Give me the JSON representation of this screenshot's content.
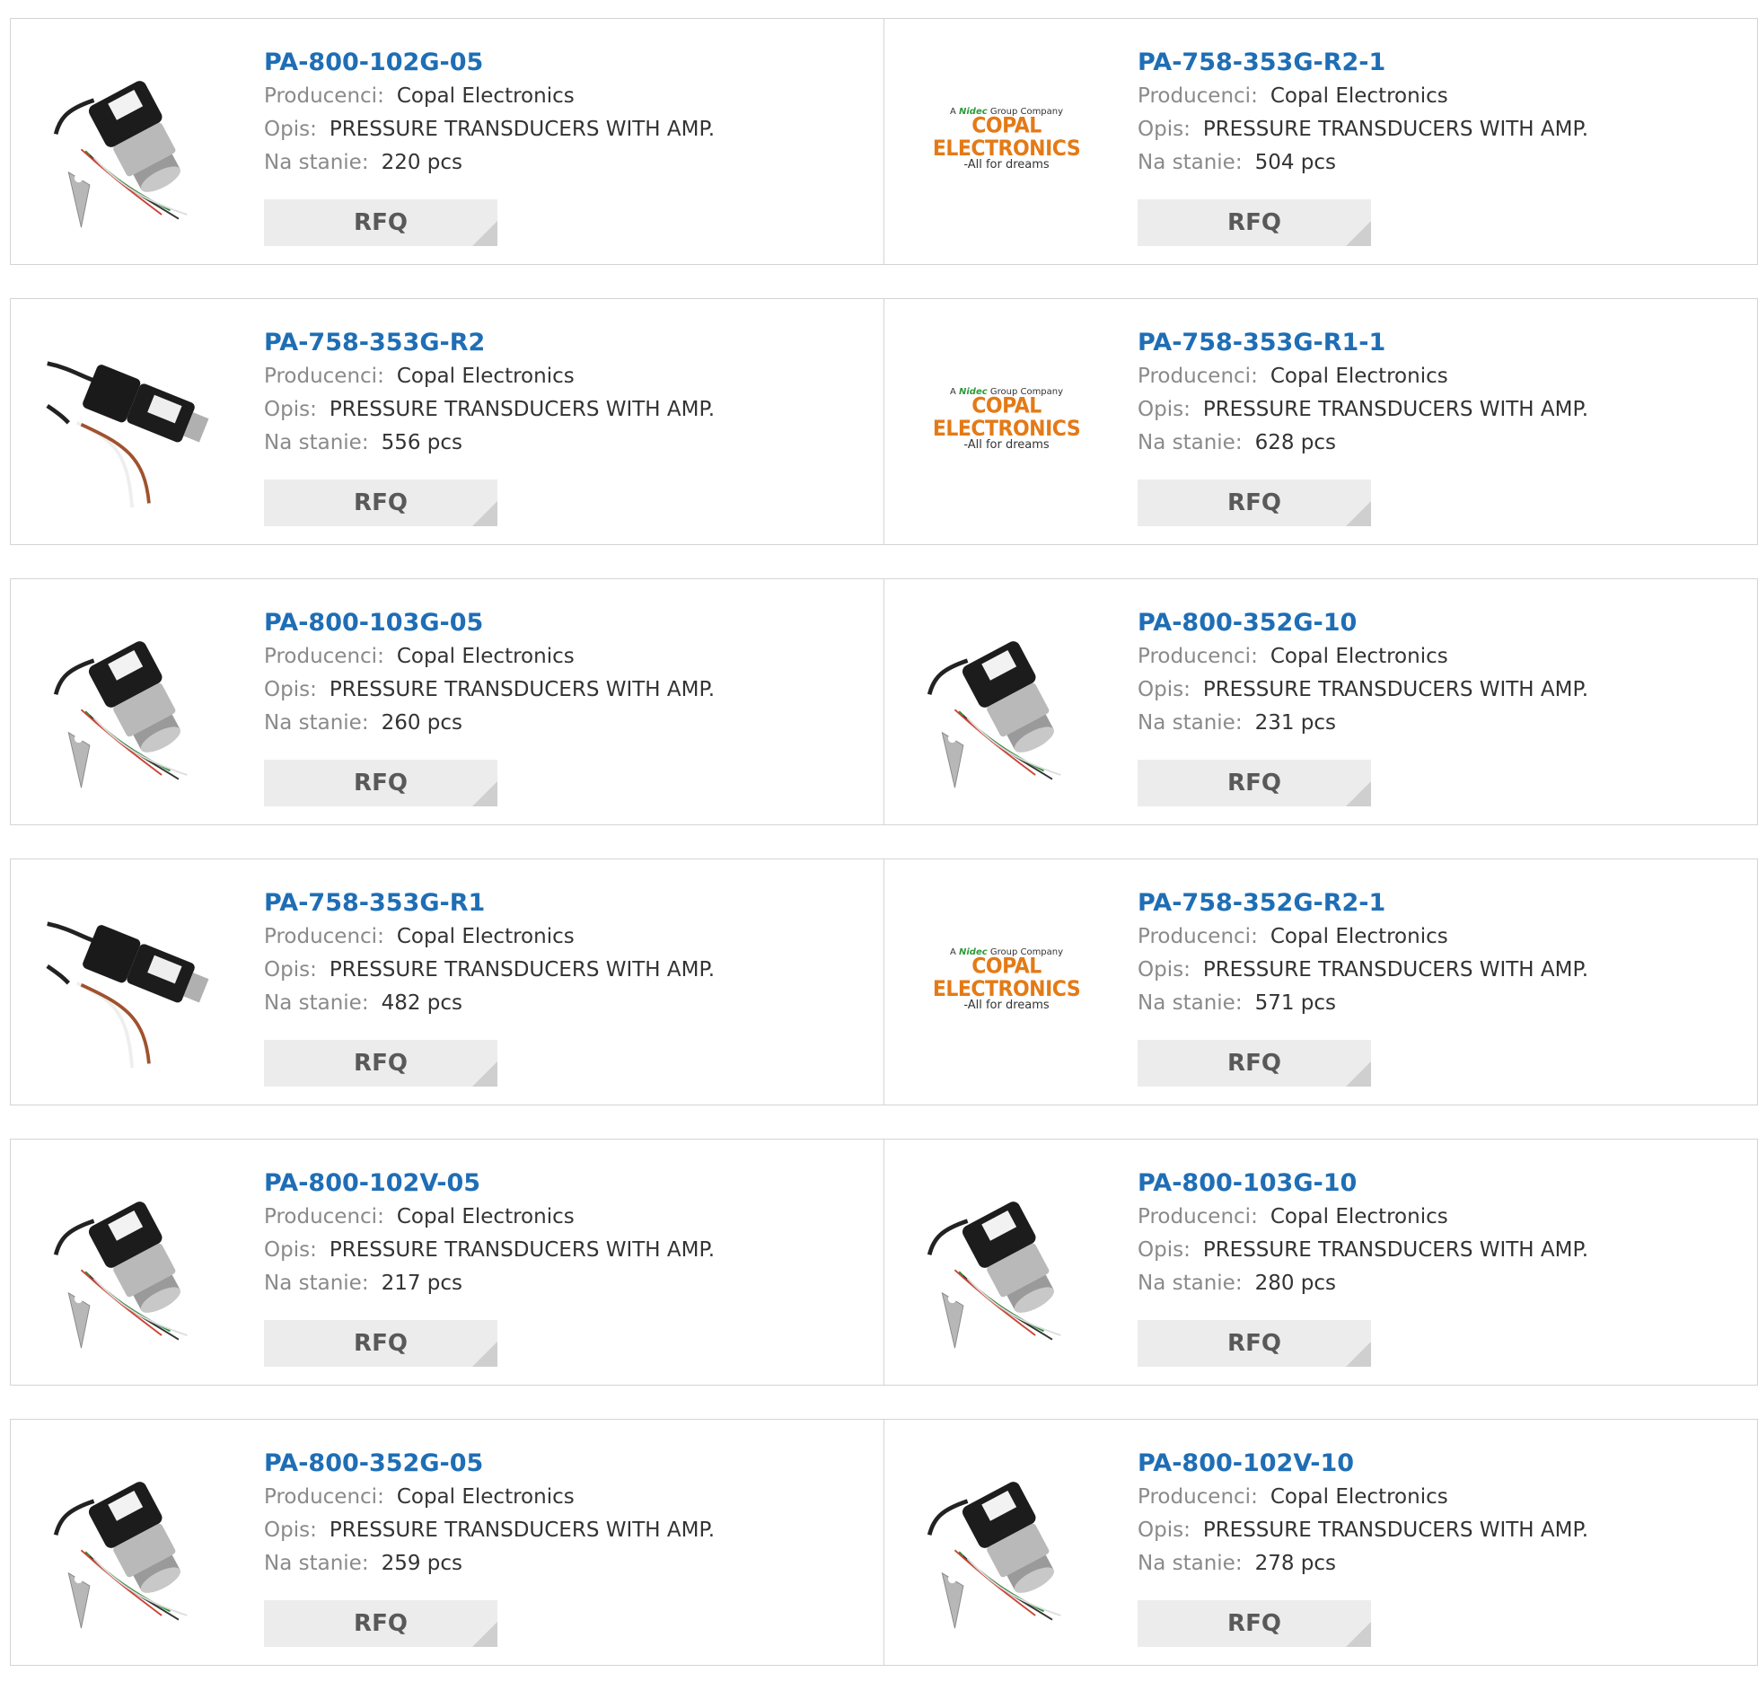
{
  "labels": {
    "manufacturer": "Producenci:",
    "description": "Opis:",
    "stock": "Na stanie:"
  },
  "rfq_label": "RFQ",
  "logo": {
    "top_prefix": "A",
    "top_brand": "Nidec",
    "top_suffix": "Group Company",
    "main": "COPAL ELECTRONICS",
    "tagline": "-All for dreams"
  },
  "colors": {
    "part_link": "#1f6eb5",
    "rfq_bg": "#ececec",
    "logo_orange": "#e47a16"
  },
  "products": [
    {
      "part": "PA-800-102G-05",
      "manufacturer": "Copal Electronics",
      "description": "PRESSURE TRANSDUCERS WITH AMP.",
      "stock": "220 pcs",
      "image": "transducer-cable-image"
    },
    {
      "part": "PA-758-353G-R2-1",
      "manufacturer": "Copal Electronics",
      "description": "PRESSURE TRANSDUCERS WITH AMP.",
      "stock": "504 pcs",
      "image": "copal-logo"
    },
    {
      "part": "PA-758-353G-R2",
      "manufacturer": "Copal Electronics",
      "description": "PRESSURE TRANSDUCERS WITH AMP.",
      "stock": "556 pcs",
      "image": "transducer-connector-image"
    },
    {
      "part": "PA-758-353G-R1-1",
      "manufacturer": "Copal Electronics",
      "description": "PRESSURE TRANSDUCERS WITH AMP.",
      "stock": "628 pcs",
      "image": "copal-logo"
    },
    {
      "part": "PA-800-103G-05",
      "manufacturer": "Copal Electronics",
      "description": "PRESSURE TRANSDUCERS WITH AMP.",
      "stock": "260 pcs",
      "image": "transducer-cable-image"
    },
    {
      "part": "PA-800-352G-10",
      "manufacturer": "Copal Electronics",
      "description": "PRESSURE TRANSDUCERS WITH AMP.",
      "stock": "231 pcs",
      "image": "transducer-cable-image"
    },
    {
      "part": "PA-758-353G-R1",
      "manufacturer": "Copal Electronics",
      "description": "PRESSURE TRANSDUCERS WITH AMP.",
      "stock": "482 pcs",
      "image": "transducer-connector-image"
    },
    {
      "part": "PA-758-352G-R2-1",
      "manufacturer": "Copal Electronics",
      "description": "PRESSURE TRANSDUCERS WITH AMP.",
      "stock": "571 pcs",
      "image": "copal-logo"
    },
    {
      "part": "PA-800-102V-05",
      "manufacturer": "Copal Electronics",
      "description": "PRESSURE TRANSDUCERS WITH AMP.",
      "stock": "217 pcs",
      "image": "transducer-cable-image"
    },
    {
      "part": "PA-800-103G-10",
      "manufacturer": "Copal Electronics",
      "description": "PRESSURE TRANSDUCERS WITH AMP.",
      "stock": "280 pcs",
      "image": "transducer-cable-image"
    },
    {
      "part": "PA-800-352G-05",
      "manufacturer": "Copal Electronics",
      "description": "PRESSURE TRANSDUCERS WITH AMP.",
      "stock": "259 pcs",
      "image": "transducer-cable-image"
    },
    {
      "part": "PA-800-102V-10",
      "manufacturer": "Copal Electronics",
      "description": "PRESSURE TRANSDUCERS WITH AMP.",
      "stock": "278 pcs",
      "image": "transducer-cable-image"
    }
  ]
}
